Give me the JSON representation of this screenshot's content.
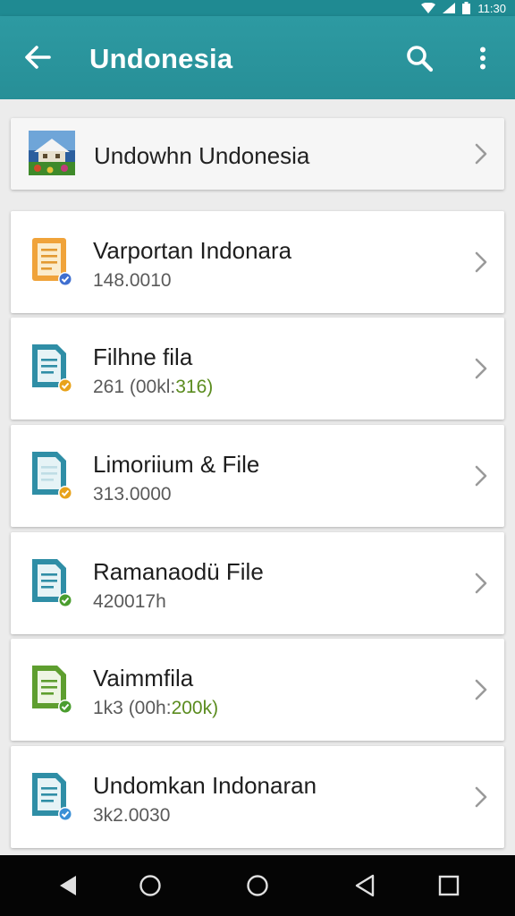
{
  "status_bar": {
    "time": "11:30"
  },
  "app_bar": {
    "title": "Undonesia",
    "back_icon": "arrow-back-icon",
    "search_icon": "search-icon",
    "more_icon": "more-vert-icon"
  },
  "header_item": {
    "label": "Undowhn Undonesia",
    "thumbnail_icon": "house-thumbnail-icon"
  },
  "files": [
    {
      "name": "Varportan Indonara",
      "meta": "148.0010",
      "icon_color": "#f0a33a",
      "badge_color": "#3f6fd0"
    },
    {
      "name": "Filhne fila",
      "meta_prefix": "261 (00kl:",
      "meta_accent": "316)",
      "icon_color": "#2f8ea6",
      "badge_color": "#e8a21a"
    },
    {
      "name": "Limoriium & File",
      "meta": "313.0000",
      "icon_color": "#2f8ea6",
      "badge_color": "#e8a21a"
    },
    {
      "name": "Ramanaodü File",
      "meta": "420017h",
      "icon_color": "#2f8ea6",
      "badge_color": "#4a9d2e"
    },
    {
      "name": "Vaimmfila",
      "meta_prefix": "1k3 (00h:",
      "meta_accent": "200k)",
      "icon_color": "#5e9e2f",
      "badge_color": "#4a9d2e"
    },
    {
      "name": "Undomkan Indonaran",
      "meta": "3k2.0030",
      "icon_color": "#2f8ea6",
      "badge_color": "#3a8fd6"
    }
  ],
  "colors": {
    "app_bar": "#2b979f",
    "accent_green": "#5b8c1f",
    "background": "#ececec"
  },
  "nav_bar": {
    "back": "nav-back-icon",
    "home": "nav-home-icon",
    "recents": "nav-recents-icon"
  }
}
